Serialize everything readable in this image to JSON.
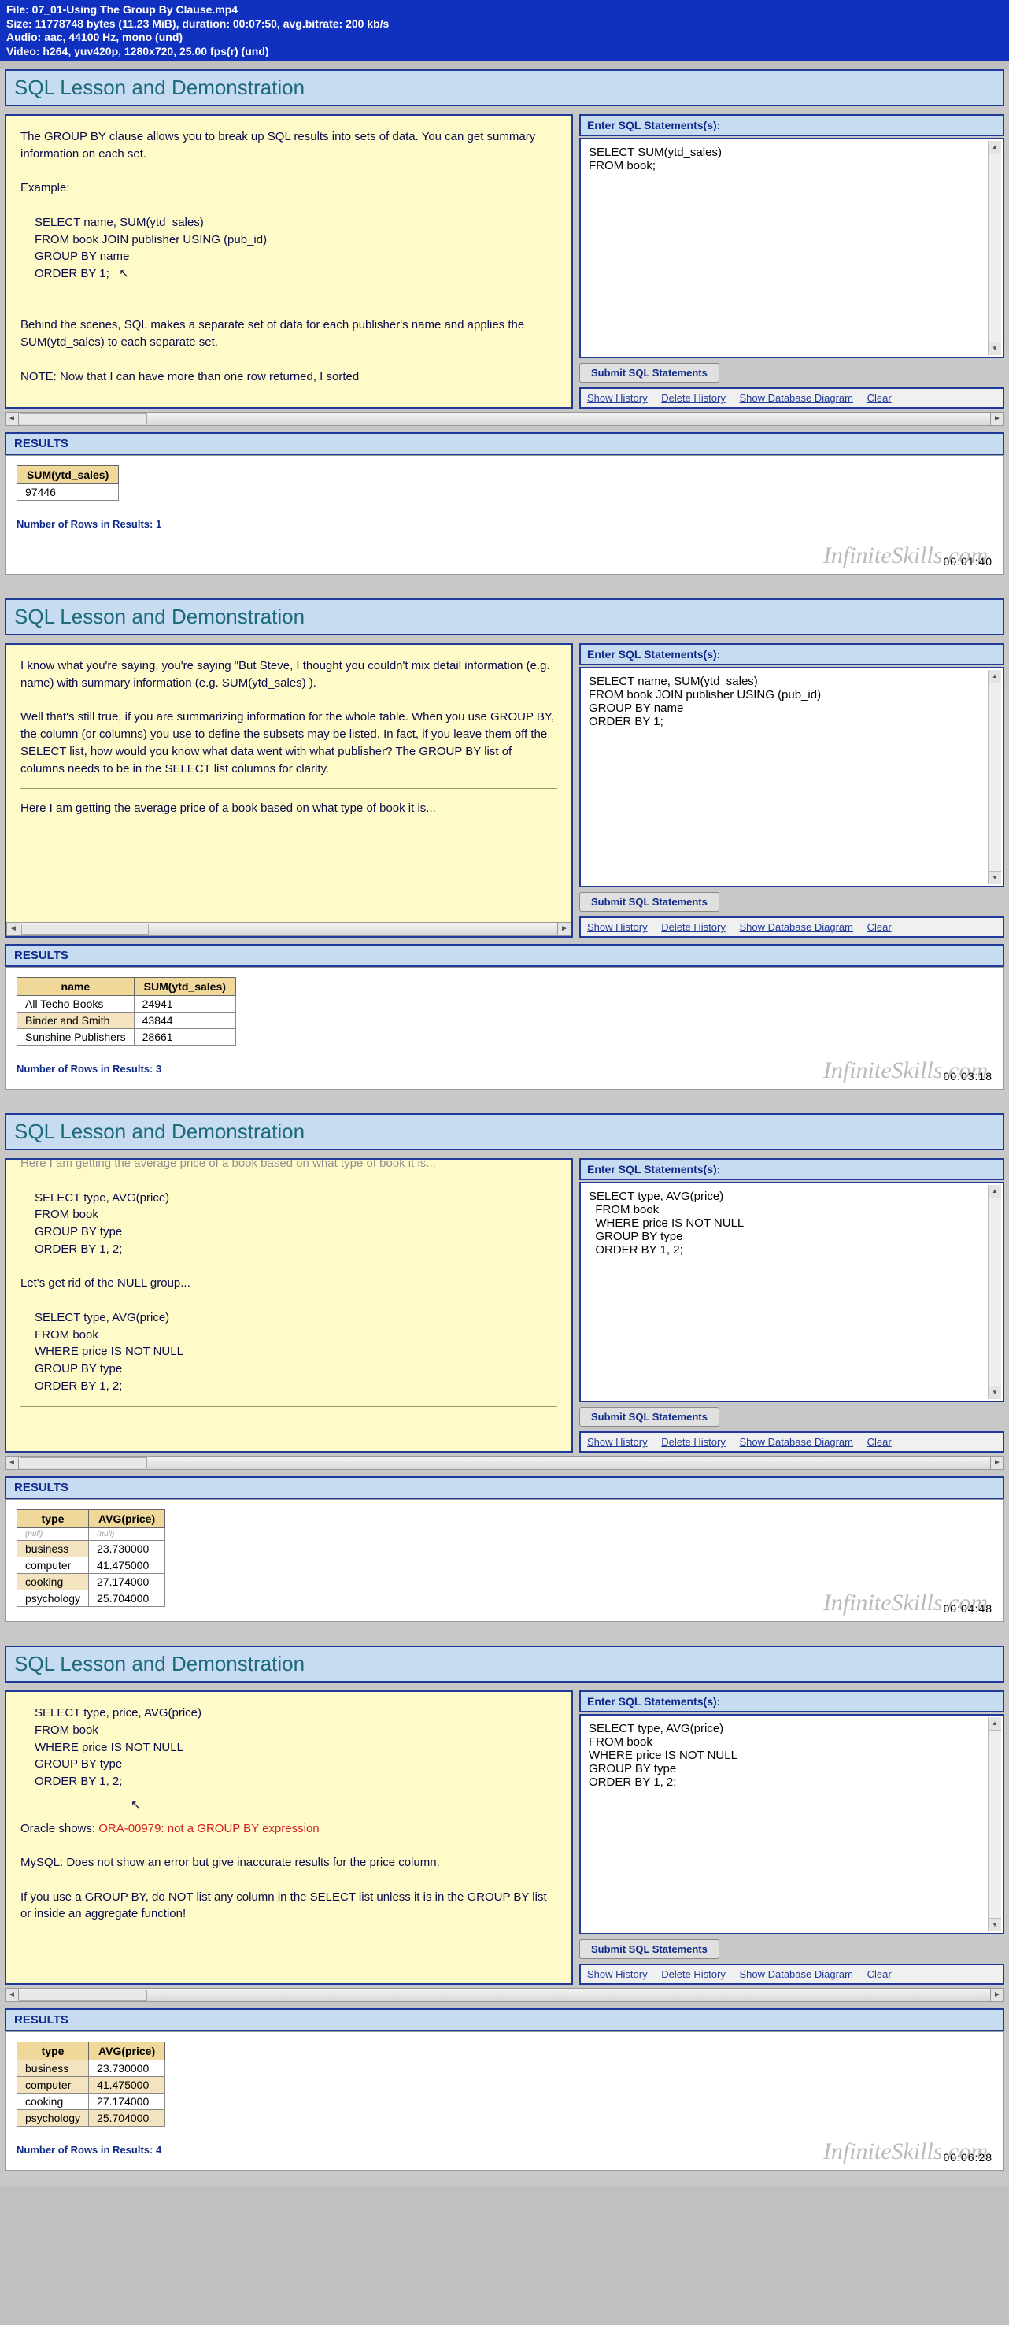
{
  "file_header": {
    "l1": "File: 07_01-Using The Group By Clause.mp4",
    "l2": "Size: 11778748 bytes (11.23 MiB), duration: 00:07:50, avg.bitrate: 200 kb/s",
    "l3": "Audio: aac, 44100 Hz, mono (und)",
    "l4": "Video: h264, yuv420p, 1280x720, 25.00 fps(r) (und)"
  },
  "common": {
    "panel_title": "SQL Lesson and Demonstration",
    "enter_sql": "Enter SQL Statements(s):",
    "submit": "Submit SQL Statements",
    "links": {
      "show_hist": "Show History",
      "del_hist": "Delete History",
      "show_diag": "Show Database Diagram",
      "clear": "Clear"
    },
    "results": "RESULTS",
    "watermark": "InfiniteSkills.com"
  },
  "f1": {
    "timecode": "00:01:40",
    "lesson_p1": "The GROUP BY clause allows you to break up SQL results into sets of data.   You can get summary information on each set.",
    "lesson_ex_label": "Example:",
    "lesson_ex_l1": "SELECT name, SUM(ytd_sales)",
    "lesson_ex_l2": "FROM book JOIN publisher USING (pub_id)",
    "lesson_ex_l3": "GROUP BY name",
    "lesson_ex_l4": "ORDER BY 1;",
    "lesson_p2": "Behind the scenes, SQL makes a separate set of data for each publisher's name and applies the SUM(ytd_sales) to each separate set.",
    "lesson_p3": "NOTE:  Now that I can have more than one row returned, I sorted",
    "sql": "SELECT SUM(ytd_sales)\nFROM book;",
    "res_h1": "SUM(ytd_sales)",
    "res_v1": "97446",
    "rowcount": "Number of Rows in Results: 1"
  },
  "f2": {
    "timecode": "00:03:18",
    "lesson_p1": "I know what you're saying, you're saying \"But Steve, I thought you couldn't mix detail information (e.g. name) with summary information (e.g. SUM(ytd_sales) ).",
    "lesson_p2": "Well that's still true, if you are summarizing information for the whole table.  When you use GROUP BY, the column (or columns) you use to define the subsets may be listed.   In fact, if you leave them off the SELECT list, how would you know what data went with what publisher?   The GROUP BY list of columns needs to be in the SELECT list columns for clarity.",
    "lesson_p3": "Here I am getting the average price of a book based on what type of book it is...",
    "sql": "SELECT name, SUM(ytd_sales)\nFROM book JOIN publisher USING (pub_id)\nGROUP BY name\nORDER BY 1;",
    "res_h1": "name",
    "res_h2": "SUM(ytd_sales)",
    "r1c1": "All Techo Books",
    "r1c2": "24941",
    "r2c1": "Binder and Smith",
    "r2c2": "43844",
    "r3c1": "Sunshine Publishers",
    "r3c2": "28661",
    "rowcount": "Number of Rows in Results: 3"
  },
  "f3": {
    "timecode": "00:04:48",
    "lesson_top": "Here I am getting the average price of a book based on what type of book it is...",
    "q1l1": "SELECT type, AVG(price)",
    "q1l2": "FROM book",
    "q1l3": "GROUP BY type",
    "q1l4": "ORDER BY 1, 2;",
    "mid": "Let's get rid of the NULL group...",
    "q2l1": "SELECT type, AVG(price)",
    "q2l2": "FROM book",
    "q2l3": "WHERE price IS NOT NULL",
    "q2l4": "GROUP BY type",
    "q2l5": "ORDER BY 1, 2;",
    "sql": "SELECT type, AVG(price)\n  FROM book\n  WHERE price IS NOT NULL\n  GROUP BY type\n  ORDER BY 1, 2;",
    "res_h1": "type",
    "res_h2": "AVG(price)",
    "r1c1": "(null)",
    "r1c2": "(null)",
    "r2c1": "business",
    "r2c2": "23.730000",
    "r3c1": "computer",
    "r3c2": "41.475000",
    "r4c1": "cooking",
    "r4c2": "27.174000",
    "r5c1": "psychology",
    "r5c2": "25.704000"
  },
  "f4": {
    "timecode": "00:06:28",
    "q1l1": "SELECT type, price, AVG(price)",
    "q1l2": "FROM book",
    "q1l3": "WHERE price IS NOT NULL",
    "q1l4": "GROUP BY type",
    "q1l5": "ORDER BY 1, 2;",
    "ora_label": "Oracle shows:  ",
    "ora_msg": "ORA-00979: not a GROUP BY expression",
    "mysql": "MySQL: Does not show an error but give inaccurate results for the price column.",
    "warn": "If you use a GROUP BY, do NOT list any column in the SELECT list unless it is in the GROUP BY list or inside an aggregate function!",
    "sql": "SELECT type, AVG(price)\nFROM book\nWHERE price IS NOT NULL\nGROUP BY type\nORDER BY 1, 2;",
    "res_h1": "type",
    "res_h2": "AVG(price)",
    "r1c1": "business",
    "r1c2": "23.730000",
    "r2c1": "computer",
    "r2c2": "41.475000",
    "r3c1": "cooking",
    "r3c2": "27.174000",
    "r4c1": "psychology",
    "r4c2": "25.704000",
    "rowcount": "Number of Rows in Results: 4"
  }
}
